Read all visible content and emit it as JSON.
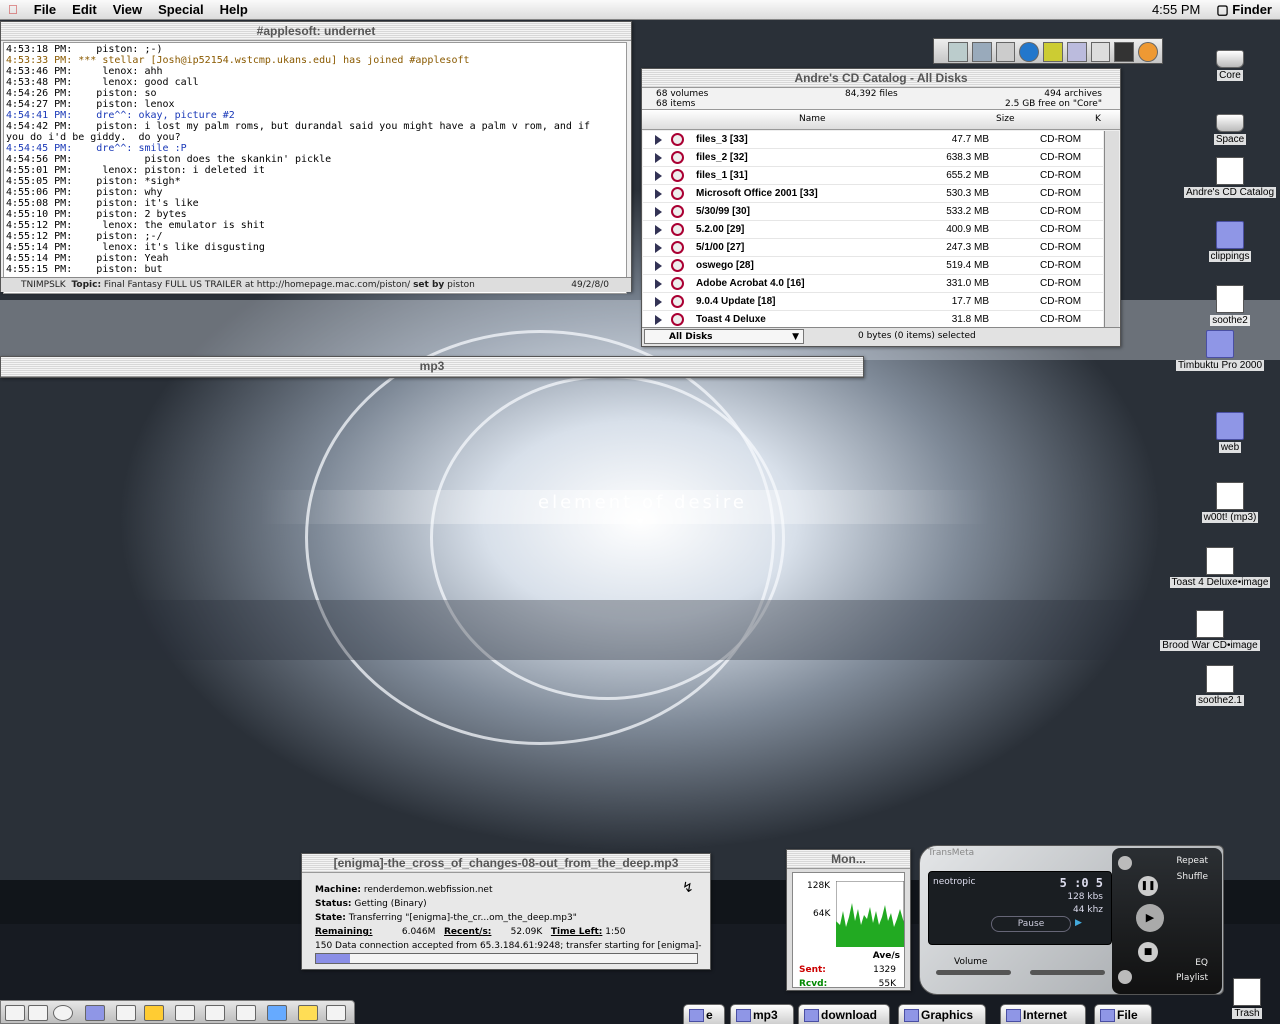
{
  "menubar": {
    "items": [
      "File",
      "Edit",
      "View",
      "Special",
      "Help"
    ],
    "clock": "4:55 PM",
    "app": "Finder"
  },
  "irc": {
    "title": "#applesoft: undernet",
    "lines": [
      {
        "text": "4:53:18 PM:    piston: ;-)",
        "cls": "t"
      },
      {
        "text": "4:53:33 PM: *** stellar [Josh@ip52154.wstcmp.ukans.edu] has joined #applesoft",
        "cls": "join"
      },
      {
        "text": "4:53:46 PM:     lenox: ahh",
        "cls": "t"
      },
      {
        "text": "4:53:48 PM:     lenox: good call",
        "cls": "t"
      },
      {
        "text": "4:54:26 PM:    piston: so",
        "cls": "t"
      },
      {
        "text": "4:54:27 PM:    piston: lenox",
        "cls": "t"
      },
      {
        "text": "4:54:41 PM:    dre^^: okay, picture #2",
        "cls": "dre"
      },
      {
        "text": "4:54:42 PM:    piston: i lost my palm roms, but durandal said you might have a palm v rom, and if",
        "cls": "t"
      },
      {
        "text": "you do i'd be giddy.  do you?",
        "cls": "t"
      },
      {
        "text": "4:54:45 PM:    dre^^: smile :P",
        "cls": "dre"
      },
      {
        "text": "4:54:56 PM:            piston does the skankin' pickle",
        "cls": "t"
      },
      {
        "text": "4:55:01 PM:     lenox: piston: i deleted it",
        "cls": "t"
      },
      {
        "text": "4:55:05 PM:    piston: *sigh*",
        "cls": "t"
      },
      {
        "text": "4:55:06 PM:    piston: why",
        "cls": "t"
      },
      {
        "text": "4:55:08 PM:    piston: it's like",
        "cls": "t"
      },
      {
        "text": "4:55:10 PM:    piston: 2 bytes",
        "cls": "t"
      },
      {
        "text": "4:55:12 PM:     lenox: the emulator is shit",
        "cls": "t"
      },
      {
        "text": "4:55:12 PM:    piston: ;-/",
        "cls": "t"
      },
      {
        "text": "4:55:14 PM:     lenox: it's like disgusting",
        "cls": "t"
      },
      {
        "text": "4:55:14 PM:    piston: Yeah",
        "cls": "t"
      },
      {
        "text": "4:55:15 PM:    piston: but",
        "cls": "t"
      }
    ],
    "modes": "TNIMPSLK",
    "topic_label": "Topic:",
    "topic": "Final Fantasy FULL US TRAILER at http://homepage.mac.com/piston/",
    "setby_label": "set by",
    "setby": "piston",
    "counts": "49/2/8/0"
  },
  "catalog": {
    "title": "Andre's CD Catalog - All Disks",
    "volumes": "68 volumes",
    "items": "68 items",
    "files": "84,392 files",
    "archives": "494 archives",
    "free": "2.5 GB free on \"Core\"",
    "col_name": "Name",
    "col_size": "Size",
    "col_kind": "K",
    "rows": [
      {
        "name": "files_3 [33]",
        "size": "47.7 MB",
        "kind": "CD-ROM"
      },
      {
        "name": "files_2 [32]",
        "size": "638.3 MB",
        "kind": "CD-ROM"
      },
      {
        "name": "files_1 [31]",
        "size": "655.2 MB",
        "kind": "CD-ROM"
      },
      {
        "name": "Microsoft Office 2001 [33]",
        "size": "530.3 MB",
        "kind": "CD-ROM"
      },
      {
        "name": "5/30/99 [30]",
        "size": "533.2 MB",
        "kind": "CD-ROM"
      },
      {
        "name": "5.2.00 [29]",
        "size": "400.9 MB",
        "kind": "CD-ROM"
      },
      {
        "name": "5/1/00 [27]",
        "size": "247.3 MB",
        "kind": "CD-ROM"
      },
      {
        "name": "oswego [28]",
        "size": "519.4 MB",
        "kind": "CD-ROM"
      },
      {
        "name": "Adobe Acrobat 4.0 [16]",
        "size": "331.0 MB",
        "kind": "CD-ROM"
      },
      {
        "name": "9.0.4 Update [18]",
        "size": "17.7 MB",
        "kind": "CD-ROM"
      },
      {
        "name": "Toast 4 Deluxe",
        "size": "31.8 MB",
        "kind": "CD-ROM"
      }
    ],
    "popup": "All Disks",
    "selection": "0 bytes (0 items) selected"
  },
  "mp3window": {
    "title": "mp3"
  },
  "wallpaper": {
    "text": "element of desire"
  },
  "download": {
    "title": "[enigma]-the_cross_of_changes-08-out_from_the_deep.mp3",
    "machine_label": "Machine:",
    "machine": "renderdemon.webfission.net",
    "status_label": "Status:",
    "status": "Getting (Binary)",
    "state_label": "State:",
    "state": "Transferring \"[enigma]-the_cr...om_the_deep.mp3\"",
    "remaining_label": "Remaining:",
    "remaining": "6.046M",
    "recent_label": "Recent/s:",
    "recent": "52.09K",
    "timeleft_label": "Time Left:",
    "timeleft": "1:50",
    "log": "150 Data connection accepted from 65.3.184.61:9248; transfer starting for [enigma]-",
    "progress": 0.09
  },
  "monitor": {
    "title": "Mon...",
    "ymax": "128K",
    "ymid": "64K",
    "ave": "Ave/s",
    "sent_label": "Sent:",
    "sent": "1329",
    "recvd_label": "Rcvd:",
    "recvd": "55K"
  },
  "player": {
    "brand": "TransMeta",
    "track": "neotropic",
    "time": "5 :0 5",
    "bitrate": "128 kbs",
    "freq": "44 khz",
    "pause": "Pause",
    "repeat": "Repeat",
    "shuffle": "Shuffle",
    "volume": "Volume",
    "eq": "EQ",
    "playlist": "Playlist"
  },
  "desktop_icons": [
    {
      "label": "Core",
      "type": "disk"
    },
    {
      "label": "Space",
      "type": "disk"
    },
    {
      "label": "Andre's CD Catalog",
      "type": "doc"
    },
    {
      "label": "clippings",
      "type": "folder"
    },
    {
      "label": "soothe2",
      "type": "doc"
    },
    {
      "label": "Timbuktu Pro 2000",
      "type": "folder"
    },
    {
      "label": "web",
      "type": "folder"
    },
    {
      "label": "w00t! (mp3)",
      "type": "doc"
    },
    {
      "label": "Toast 4 Deluxe•image",
      "type": "doc"
    },
    {
      "label": "Brood War CD•image",
      "type": "doc"
    },
    {
      "label": "soothe2.1",
      "type": "doc"
    },
    {
      "label": "Trash",
      "type": "doc"
    }
  ],
  "tabs": [
    "e",
    "mp3",
    "download",
    "Graphics",
    "Internet",
    "File"
  ]
}
